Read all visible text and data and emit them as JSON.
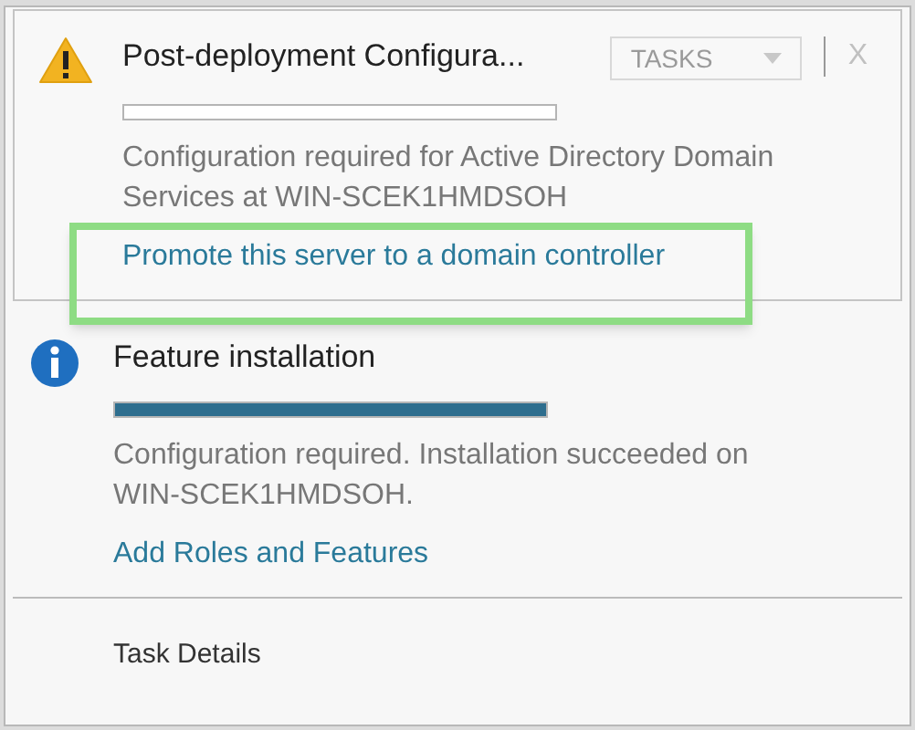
{
  "notifications": [
    {
      "kind": "warning",
      "title": "Post-deployment Configura...",
      "level": 0,
      "description": "Configuration required for Active Directory Domain Services at WIN-SCEK1HMDSOH",
      "link": "Promote this server to a domain controller",
      "highlighted": true,
      "tasks_button": {
        "label": "TASKS",
        "disabled": true
      },
      "close": "X"
    },
    {
      "kind": "info",
      "title": "Feature installation",
      "level": 1,
      "description": "Configuration required. Installation succeeded on WIN-SCEK1HMDSOH.",
      "link": "Add Roles and Features",
      "highlighted": false
    }
  ],
  "footer": {
    "link": "Task Details"
  }
}
